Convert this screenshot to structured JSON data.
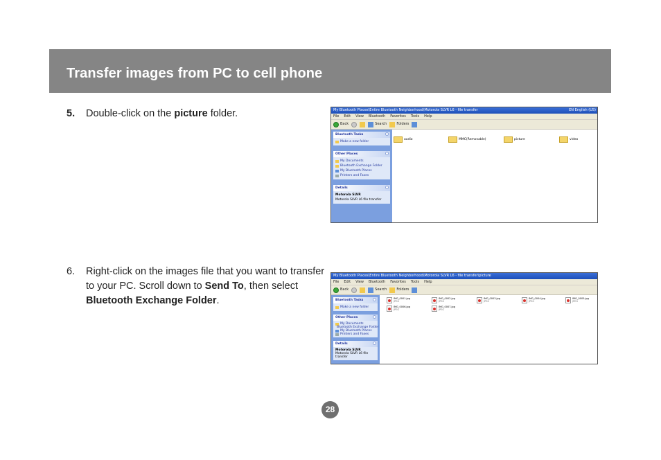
{
  "header": {
    "title": "Transfer images from PC to cell phone"
  },
  "steps": [
    {
      "number": "5.",
      "text_before": "Double-click on the ",
      "bold": "picture",
      "text_after": " folder."
    },
    {
      "number": "6.",
      "text_before": "Right-click on the images file that you want to transfer to your PC. Scroll down to ",
      "bold1": "Send To",
      "text_mid": ", then select ",
      "bold2": "Bluetooth Exchange Folder",
      "text_after": "."
    }
  ],
  "screenshot1": {
    "title": "My Bluetooth Places\\Entire Bluetooth Neighborhood\\Motorola SLVR L6 - file transfer",
    "title_right": "EN  English (US)",
    "menu": [
      "File",
      "Edit",
      "View",
      "Bluetooth",
      "Favorites",
      "Tools",
      "Help"
    ],
    "toolbar": {
      "back": "Back",
      "search": "Search",
      "folders": "Folders"
    },
    "panels": [
      {
        "title": "Bluetooth Tasks",
        "items": [
          "Make a new folder"
        ]
      },
      {
        "title": "Other Places",
        "items": [
          "My Documents",
          "Bluetooth Exchange Folder",
          "My Bluetooth Places",
          "Printers and Faxes"
        ]
      },
      {
        "title": "Details",
        "lines": [
          "Motorola SLVR",
          "Motorola SLVR L6 file transfer"
        ]
      }
    ],
    "folders": [
      "audio",
      "MMC(Removable)",
      "picture",
      "video"
    ]
  },
  "screenshot2": {
    "title": "My Bluetooth Places\\Entire Bluetooth Neighborhood\\Motorola SLVR L6 - file transfer\\picture",
    "menu": [
      "File",
      "Edit",
      "View",
      "Bluetooth",
      "Favorites",
      "Tools",
      "Help"
    ],
    "toolbar": {
      "back": "Back",
      "search": "Search",
      "folders": "Folders"
    },
    "panels": [
      {
        "title": "Bluetooth Tasks",
        "items": [
          "Make a new folder"
        ]
      },
      {
        "title": "Other Places",
        "items": [
          "My Documents",
          "Bluetooth Exchange Folder",
          "My Bluetooth Places",
          "Printers and Faxes"
        ]
      },
      {
        "title": "Details",
        "lines": [
          "Motorola SLVR",
          "Motorola SLVR L6 file transfer"
        ]
      }
    ],
    "files": [
      {
        "name": "IMG_0001.jpg",
        "meta": "JPEG"
      },
      {
        "name": "IMG_0002.jpg",
        "meta": "JPEG"
      },
      {
        "name": "IMG_0003.jpg",
        "meta": "JPEG"
      },
      {
        "name": "IMG_0004.jpg",
        "meta": "JPEG"
      },
      {
        "name": "IMG_0005.jpg",
        "meta": "JPEG"
      },
      {
        "name": "IMG_0006.jpg",
        "meta": "JPEG"
      },
      {
        "name": "IMG_0007.jpg",
        "meta": "JPEG"
      }
    ]
  },
  "page_number": "28"
}
